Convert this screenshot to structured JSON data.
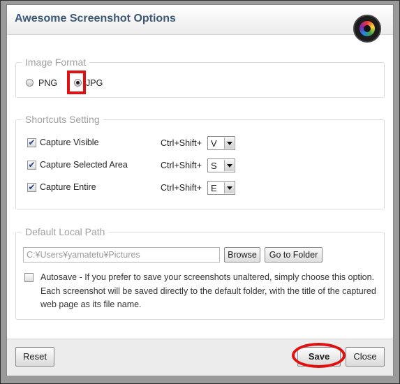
{
  "dialog": {
    "title": "Awesome Screenshot Options",
    "camera_icon": "camera-lens-icon"
  },
  "image_format": {
    "legend": "Image Format",
    "options": [
      {
        "label": "PNG",
        "selected": false
      },
      {
        "label": "JPG",
        "selected": true
      }
    ]
  },
  "shortcuts": {
    "legend": "Shortcuts Setting",
    "prefix": "Ctrl+Shift+",
    "items": [
      {
        "label": "Capture Visible",
        "checked": true,
        "key": "V"
      },
      {
        "label": "Capture Selected Area",
        "checked": true,
        "key": "S"
      },
      {
        "label": "Capture Entire",
        "checked": true,
        "key": "E"
      }
    ]
  },
  "local_path": {
    "legend": "Default Local Path",
    "path_value": "C:¥Users¥yamatetu¥Pictures",
    "browse_label": "Browse",
    "goto_label": "Go to Folder",
    "autosave_checked": false,
    "autosave_text": "Autosave - If you prefer to save your screenshots unaltered, simply choose this option. Each screenshot will be saved directly to the default folder, with the title of the captured web page as its file name."
  },
  "footer": {
    "reset_label": "Reset",
    "save_label": "Save",
    "close_label": "Close"
  },
  "annotation_color": "#e01010",
  "title_color": "#3b5876"
}
